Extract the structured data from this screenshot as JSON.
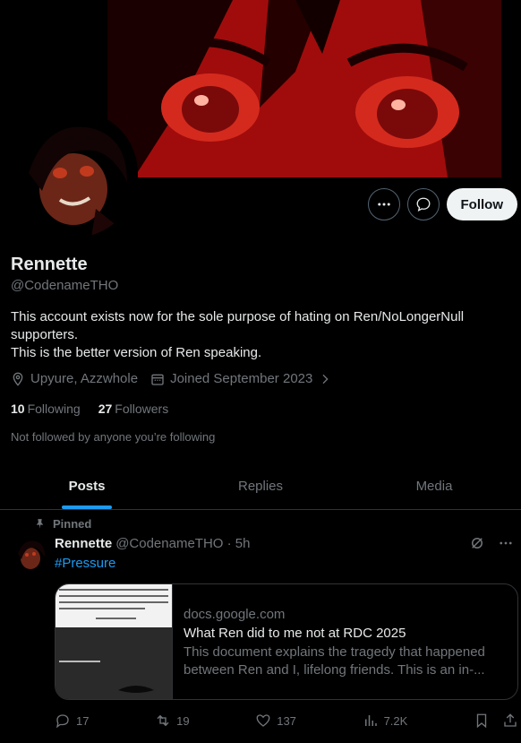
{
  "profile": {
    "name": "Rennette",
    "handle": "@CodenameTHO",
    "bio_line1": "This account exists now for the sole purpose of hating on Ren/NoLongerNull supporters.",
    "bio_line2": "This is the better version of Ren speaking.",
    "location": "Upyure, Azzwhole",
    "joined": "Joined September 2023",
    "following_count": "10",
    "following_label": "Following",
    "followers_count": "27",
    "followers_label": "Followers",
    "not_followed": "Not followed by anyone you’re following"
  },
  "buttons": {
    "more_icon": "more-icon",
    "message_icon": "message-icon",
    "follow_label": "Follow"
  },
  "tabs": [
    {
      "label": "Posts",
      "active": true
    },
    {
      "label": "Replies",
      "active": false
    },
    {
      "label": "Media",
      "active": false
    }
  ],
  "post": {
    "pinned_label": "Pinned",
    "author_name": "Rennette",
    "author_handle": "@CodenameTHO · 5h",
    "hashtag": "#Pressure",
    "card": {
      "domain": "docs.google.com",
      "title": "What Ren did to me not at RDC 2025",
      "description": "This document explains the tragedy that happened between Ren and I, lifelong friends. This is an in-..."
    },
    "stats": {
      "replies": "17",
      "reposts": "19",
      "likes": "137",
      "views": "7.2K"
    }
  },
  "colors": {
    "accent": "#1d9bf0",
    "background": "#000000",
    "text": "#e7e9ea",
    "muted": "#71767b",
    "border": "#2f3336",
    "banner_red": "#b11010"
  }
}
